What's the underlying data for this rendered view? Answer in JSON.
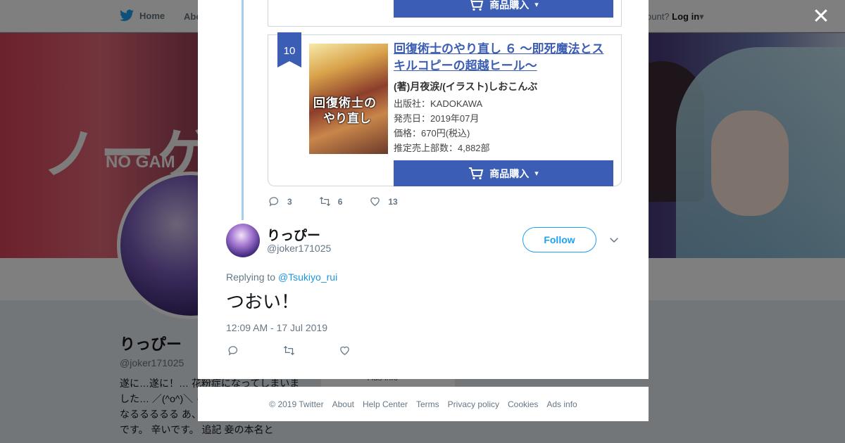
{
  "topnav": {
    "home_label": "Home",
    "about_label": "Abo",
    "account_prompt": "ccount?",
    "login_label": "Log in"
  },
  "banner": {
    "logo_text": "ノーゲー",
    "logo_sub": "NO GAM"
  },
  "profile": {
    "name": "りっぴー",
    "handle": "@joker171025",
    "bio": "遂に…遂に！… 花粉症になってしまいました… ／(^o^)＼ らい 一度した設定 なくなるるるるる あ、目のかゆみがすん ごいです。 辛いです。 追記 妾の本名と",
    "card_text": "Ads info"
  },
  "embedded_card": {
    "buy_label": "商品購入",
    "rank": "10",
    "cover_title_line1": "回復術士の",
    "cover_title_line2": "やり直し",
    "title": "回復術士のやり直し ６ ～即死魔法とスキルコピーの超越ヒール～",
    "author": "(著)月夜涙/(イラスト)しおこんぶ",
    "publisher": "出版社：KADOKAWA",
    "release": "発売日：2019年07月",
    "price": "価格：670円(税込)",
    "sales": "推定売上部数：4,882部"
  },
  "parent_actions": {
    "replies": "3",
    "retweets": "6",
    "likes": "13"
  },
  "tweet": {
    "author_name": "りっぴー",
    "author_handle": "@joker171025",
    "follow_label": "Follow",
    "replying_prefix": "Replying to",
    "replying_to": "@Tsukiyo_rui",
    "text": "つおい！",
    "timestamp": "12:09 AM - 17 Jul 2019"
  },
  "footer": {
    "copyright": "© 2019 Twitter",
    "links": [
      "About",
      "Help Center",
      "Terms",
      "Privacy policy",
      "Cookies",
      "Ads info"
    ]
  },
  "icons": {
    "close": "close-icon",
    "cart": "cart-icon",
    "reply": "reply-icon",
    "retweet": "retweet-icon",
    "like": "heart-icon",
    "caret": "chevron-down-icon",
    "twitter": "twitter-bird-icon"
  },
  "colors": {
    "accent": "#1da1f2",
    "buy_button": "#3b5db3",
    "thread_line": "#9fd0f0",
    "overlay": "rgba(0,0,0,0.5)"
  }
}
